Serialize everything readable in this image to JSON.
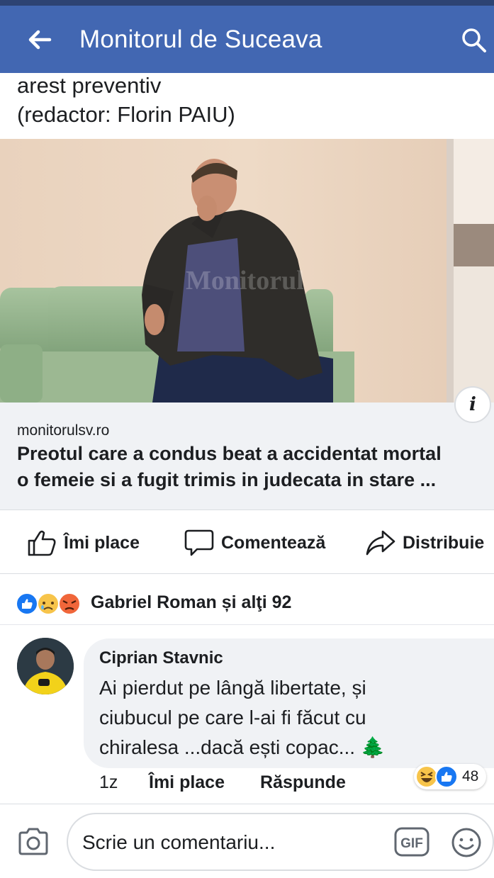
{
  "header": {
    "title": "Monitorul de Suceava",
    "back_icon": "arrow-left-icon",
    "search_icon": "search-icon",
    "bg_color": "#4267b2"
  },
  "post": {
    "text_line1": "arest preventiv",
    "text_line2": "(redactor: Florin PAIU)",
    "photo_watermark": "Monitorul"
  },
  "link_preview": {
    "domain": "monitorulsv.ro",
    "title_line1": "Preotul care a condus beat a accidentat mortal",
    "title_line2": "o femeie si a fugit trimis in judecata in stare ...",
    "info_label": "i"
  },
  "actions": {
    "like": "Îmi place",
    "comment": "Comentează",
    "share": "Distribuie"
  },
  "reactions": {
    "summary": "Gabriel Roman și alţi 92",
    "types": [
      "like",
      "sad",
      "angry"
    ]
  },
  "comment": {
    "author": "Ciprian Stavnic",
    "line1": "Ai pierdut pe lângă libertate, și",
    "line2": "ciubucul pe care l-ai fi făcut cu",
    "line3": "chiralesa ...dacă ești copac... 🌲",
    "time": "1z",
    "like_label": "Îmi place",
    "reply_label": "Răspunde",
    "reaction_count": "48",
    "reaction_types": [
      "haha",
      "like"
    ]
  },
  "composer": {
    "placeholder": "Scrie un comentariu...",
    "gif_label": "GIF",
    "camera_icon": "camera-icon",
    "emoji_icon": "emoji-icon"
  }
}
